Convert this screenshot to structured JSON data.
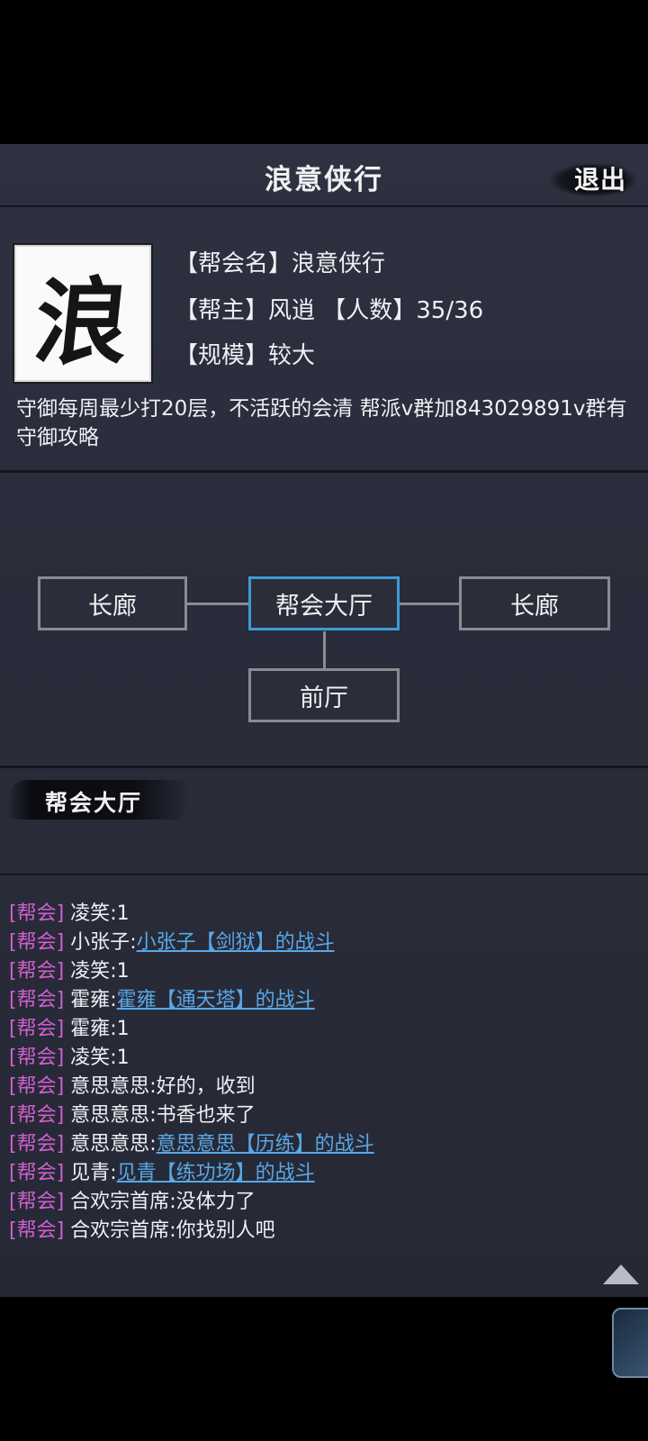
{
  "header": {
    "title": "浪意侠行",
    "exit_label": "退出"
  },
  "guild": {
    "logo_char": "浪",
    "name_line": "【帮会名】浪意侠行",
    "leader_line": "【帮主】风逍 【人数】35/36",
    "scale_line": "【规模】较大",
    "description": "守御每周最少打20层，不活跃的会清 帮派v群加843029891v群有守御攻略"
  },
  "map": {
    "rooms": [
      {
        "label": "长廊"
      },
      {
        "label": "帮会大厅"
      },
      {
        "label": "长廊"
      },
      {
        "label": "前厅"
      }
    ]
  },
  "section": {
    "label": "帮会大厅"
  },
  "chat": {
    "tag": "[帮会]",
    "messages": [
      {
        "name": "凌笑",
        "text": ":1",
        "link": ""
      },
      {
        "name": "小张子",
        "text": ":",
        "link": "小张子【剑狱】的战斗"
      },
      {
        "name": "凌笑",
        "text": ":1",
        "link": ""
      },
      {
        "name": "霍雍",
        "text": ":",
        "link": "霍雍【通天塔】的战斗"
      },
      {
        "name": "霍雍",
        "text": ":1",
        "link": ""
      },
      {
        "name": "凌笑",
        "text": ":1",
        "link": ""
      },
      {
        "name": "意思意思",
        "text": ":好的，收到",
        "link": ""
      },
      {
        "name": "意思意思",
        "text": ":书香也来了",
        "link": ""
      },
      {
        "name": "意思意思",
        "text": ":",
        "link": "意思意思【历练】的战斗"
      },
      {
        "name": "见青",
        "text": ":",
        "link": "见青【练功场】的战斗"
      },
      {
        "name": "合欢宗首席",
        "text": ":没体力了",
        "link": ""
      },
      {
        "name": "合欢宗首席",
        "text": ":你找别人吧",
        "link": ""
      }
    ]
  },
  "colors": {
    "accent": "#3e9ad6",
    "tag": "#d25fd0",
    "link": "#58a8e8"
  }
}
